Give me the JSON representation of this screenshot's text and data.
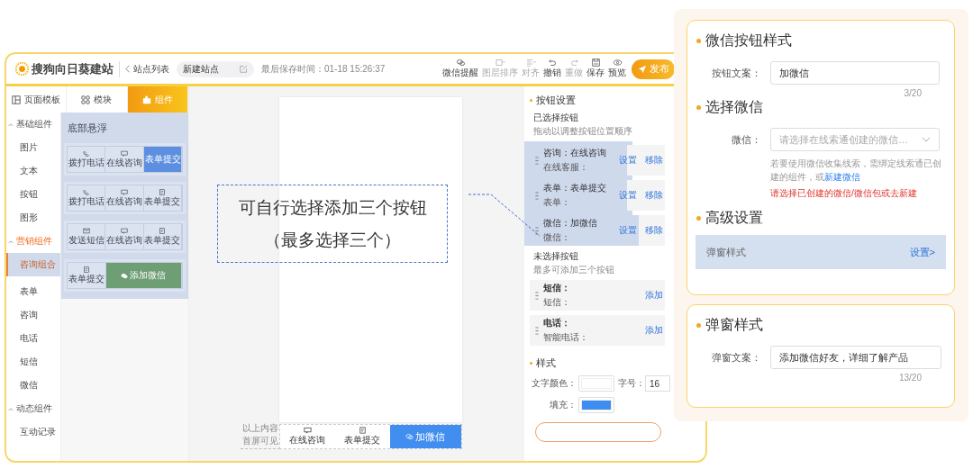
{
  "app": {
    "logo": "搜狗向日葵建站",
    "back_link": "站点列表",
    "site_name": "新建站点",
    "saved_time": "最后保存时间：01-18 15:26:37"
  },
  "toolbar": [
    {
      "label": "微信提醒",
      "kind": "wechat",
      "disabled": false
    },
    {
      "label": "图层排序",
      "kind": "layers",
      "disabled": true
    },
    {
      "label": "对齐",
      "kind": "align",
      "disabled": true
    },
    {
      "label": "撤销",
      "kind": "undo",
      "disabled": false
    },
    {
      "label": "重做",
      "kind": "redo",
      "disabled": true
    },
    {
      "label": "保存",
      "kind": "save",
      "disabled": false
    },
    {
      "label": "预览",
      "kind": "preview",
      "disabled": false
    }
  ],
  "publish_button": "发布",
  "panel_tabs": [
    {
      "label": "页面模板",
      "kind": "template",
      "selected": false
    },
    {
      "label": "模块",
      "kind": "module",
      "selected": false
    },
    {
      "label": "组件",
      "kind": "component",
      "selected": true
    }
  ],
  "categories": [
    {
      "label": "基础组件",
      "expanded": true,
      "children": [
        {
          "label": "图片",
          "selected": false
        },
        {
          "label": "文本",
          "selected": false
        },
        {
          "label": "按钮",
          "selected": false
        },
        {
          "label": "图形",
          "selected": false
        }
      ]
    },
    {
      "label": "营销组件",
      "expanded": true,
      "children": [
        {
          "label": "咨询组合",
          "selected": true
        },
        {
          "label": "表单",
          "selected": false
        },
        {
          "label": "咨询",
          "selected": false
        },
        {
          "label": "电话",
          "selected": false
        },
        {
          "label": "短信",
          "selected": false
        },
        {
          "label": "微信",
          "selected": false
        }
      ]
    },
    {
      "label": "动态组件",
      "expanded": true,
      "children": [
        {
          "label": "互动记录",
          "selected": false
        }
      ]
    }
  ],
  "template_panel": {
    "title": "底部悬浮",
    "cards": [
      {
        "buttons": [
          {
            "label": "拨打电话",
            "kind": "phone"
          },
          {
            "label": "在线咨询",
            "kind": "chat"
          },
          {
            "label": "表单提交",
            "kind": "form",
            "color": "#5d8fe0"
          }
        ]
      },
      {
        "buttons": [
          {
            "label": "拨打电话",
            "kind": "phone"
          },
          {
            "label": "在线咨询",
            "kind": "chat"
          },
          {
            "label": "表单提交",
            "kind": "form"
          }
        ]
      },
      {
        "buttons": [
          {
            "label": "发送短信",
            "kind": "sms"
          },
          {
            "label": "在线咨询",
            "kind": "chat"
          },
          {
            "label": "表单提交",
            "kind": "form"
          }
        ]
      },
      {
        "buttons": [
          {
            "label": "表单提交",
            "kind": "form"
          },
          {
            "label": "添加微信",
            "kind": "wechat",
            "color": "#6e9e74"
          }
        ]
      }
    ]
  },
  "phone_preview": {
    "fold_note": [
      "以上内容",
      "首屏可见"
    ],
    "buttons": [
      {
        "label": "在线咨询",
        "kind": "chat"
      },
      {
        "label": "表单提交",
        "kind": "form"
      },
      {
        "label": "加微信",
        "kind": "wechat",
        "color": "#418ef0"
      }
    ]
  },
  "annotation": {
    "lines": [
      "可自行选择添加三个按钮",
      "（最多选择三个）"
    ]
  },
  "button_settings": {
    "title": "按钮设置",
    "selected_heading": "已选择按钮",
    "selected_hint": "拖动以调整按钮位置顺序",
    "selected": [
      {
        "title": "咨询：在线咨询",
        "subtitle": "在线客服：",
        "actions": [
          "设置",
          "移除"
        ],
        "highlight": false
      },
      {
        "title": "表单：表单提交",
        "subtitle": "表单：",
        "actions": [
          "设置",
          "移除"
        ],
        "highlight": false
      },
      {
        "title": "微信：加微信",
        "subtitle": "微信：",
        "actions": [
          "设置",
          "移除"
        ],
        "highlight": true
      }
    ],
    "unselected_heading": "未选择按钮",
    "unselected_hint": "最多可添加三个按钮",
    "unselected": [
      {
        "title": "短信：",
        "subtitle": "短信：",
        "action": "添加"
      },
      {
        "title": "电话：",
        "subtitle": "智能电话：",
        "action": "添加"
      }
    ]
  },
  "style_settings": {
    "title": "样式",
    "font_size_label": "字号：",
    "font_size": "16",
    "colors": [
      {
        "label": "文字颜色：",
        "color": "#ffffff"
      },
      {
        "label": "填充：",
        "color": "#3d8ef0"
      }
    ]
  },
  "wechat_button_panel": {
    "title": "微信按钮样式",
    "text_label": "按钮文案：",
    "text_value": "加微信",
    "text_count": "3/20",
    "select_title": "选择微信",
    "select_label": "微信：",
    "select_placeholder": "请选择在线索通创建的微信…",
    "help_text": "若要使用微信收集线索，需绑定线索通已创建的组件，或",
    "help_link": "新建微信",
    "error_text": "请选择已创建的微信/微信包或去新建",
    "advanced_title": "高级设置",
    "advanced_row": "弹窗样式",
    "advanced_link": "设置>"
  },
  "popup_panel": {
    "title": "弹窗样式",
    "text_label": "弹窗文案：",
    "text_value": "添加微信好友，详细了解产品",
    "text_count": "13/20"
  }
}
